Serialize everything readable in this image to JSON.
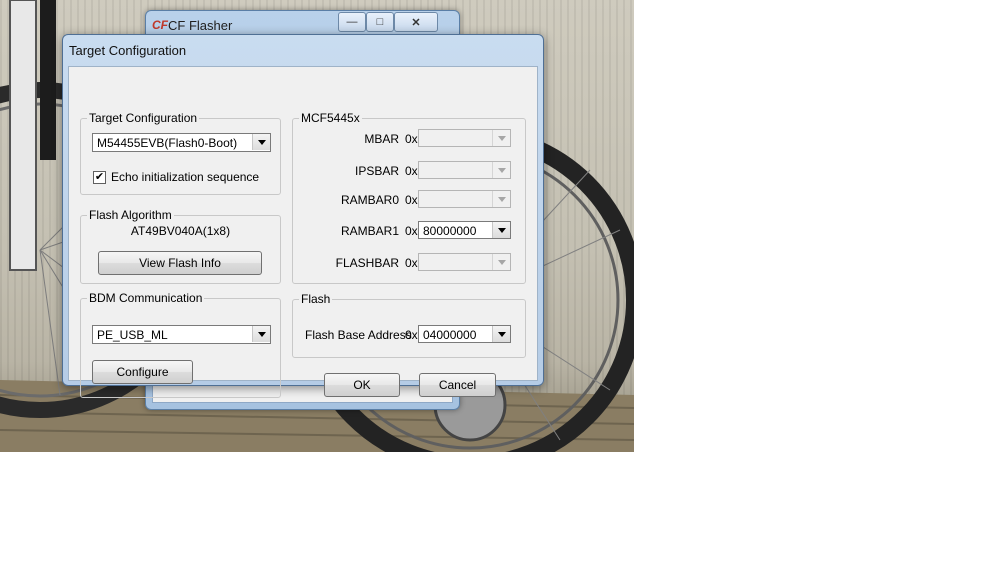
{
  "background_window": {
    "title": "CF Flasher",
    "logo": "CF",
    "minimize_icon": "—",
    "maximize_icon": "□",
    "close_icon": "✕"
  },
  "dialog": {
    "title": "Target Configuration",
    "target_group": {
      "legend": "Target Configuration",
      "target_value": "M54455EVB(Flash0-Boot)",
      "echo_checkbox": {
        "label": "Echo initialization sequence",
        "checked": true,
        "mark": "✔"
      }
    },
    "flash_algo_group": {
      "legend": "Flash Algorithm",
      "algorithm": "AT49BV040A(1x8)",
      "view_button": "View Flash Info"
    },
    "bdm_group": {
      "legend": "BDM Communication",
      "interface_value": "PE_USB_ML",
      "configure_button": "Configure"
    },
    "mcf_group": {
      "legend": "MCF5445x",
      "prefix": "0x",
      "registers": [
        {
          "name": "MBAR",
          "value": "",
          "enabled": false
        },
        {
          "name": "IPSBAR",
          "value": "",
          "enabled": false
        },
        {
          "name": "RAMBAR0",
          "value": "",
          "enabled": false
        },
        {
          "name": "RAMBAR1",
          "value": "80000000",
          "enabled": true
        },
        {
          "name": "FLASHBAR",
          "value": "",
          "enabled": false
        }
      ]
    },
    "flash_group": {
      "legend": "Flash",
      "base_label": "Flash Base Address",
      "prefix": "0x",
      "base_value": "04000000"
    },
    "ok_button": "OK",
    "cancel_button": "Cancel"
  }
}
